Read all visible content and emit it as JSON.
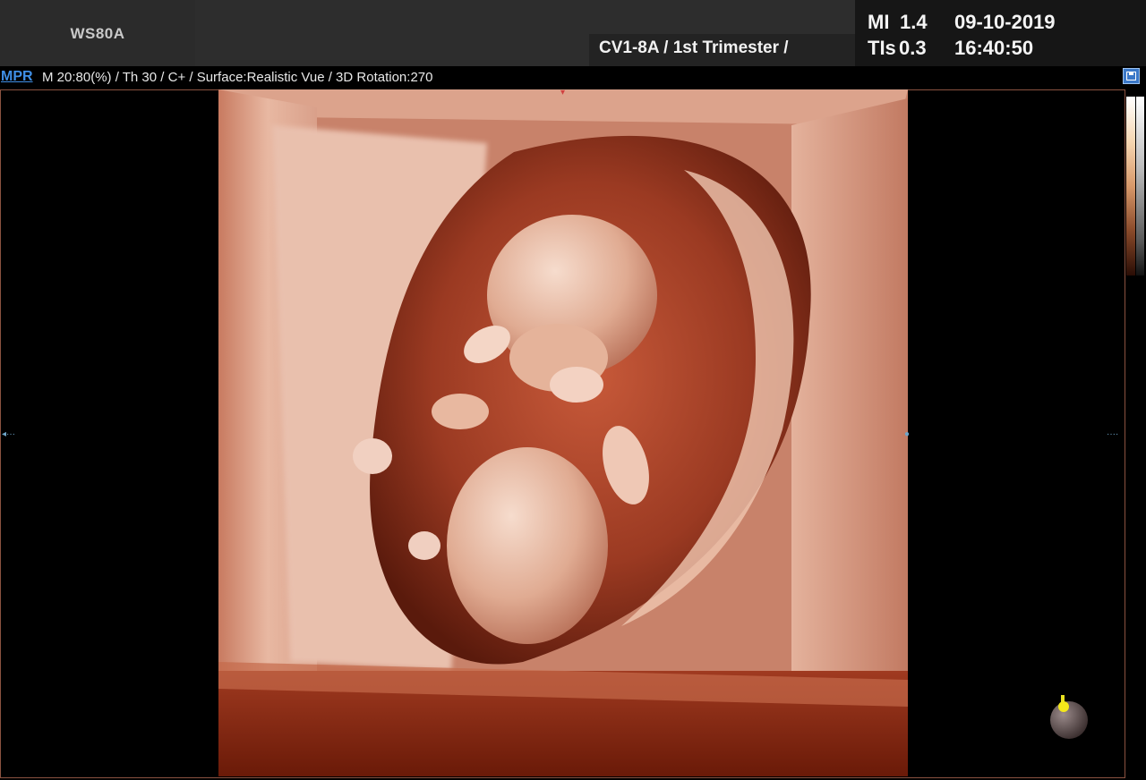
{
  "header": {
    "device": "WS80A",
    "probe_preset": "CV1-8A / 1st Trimester /",
    "mi_label": "MI",
    "mi_value": "1.4",
    "tis_label": "TIs",
    "tis_value": "0.3",
    "date": "09-10-2019",
    "time": "16:40:50"
  },
  "status": {
    "mode": "MPR",
    "params": "M 20:80(%) / Th 30 / C+ / Surface:Realistic Vue / 3D Rotation:270"
  },
  "colors": {
    "mode_accent": "#3f8fe6",
    "viewport_border": "#8a5240",
    "render_tint": "#c06a4f"
  },
  "icons": [
    "save-icon",
    "orientation-marker-icon"
  ]
}
